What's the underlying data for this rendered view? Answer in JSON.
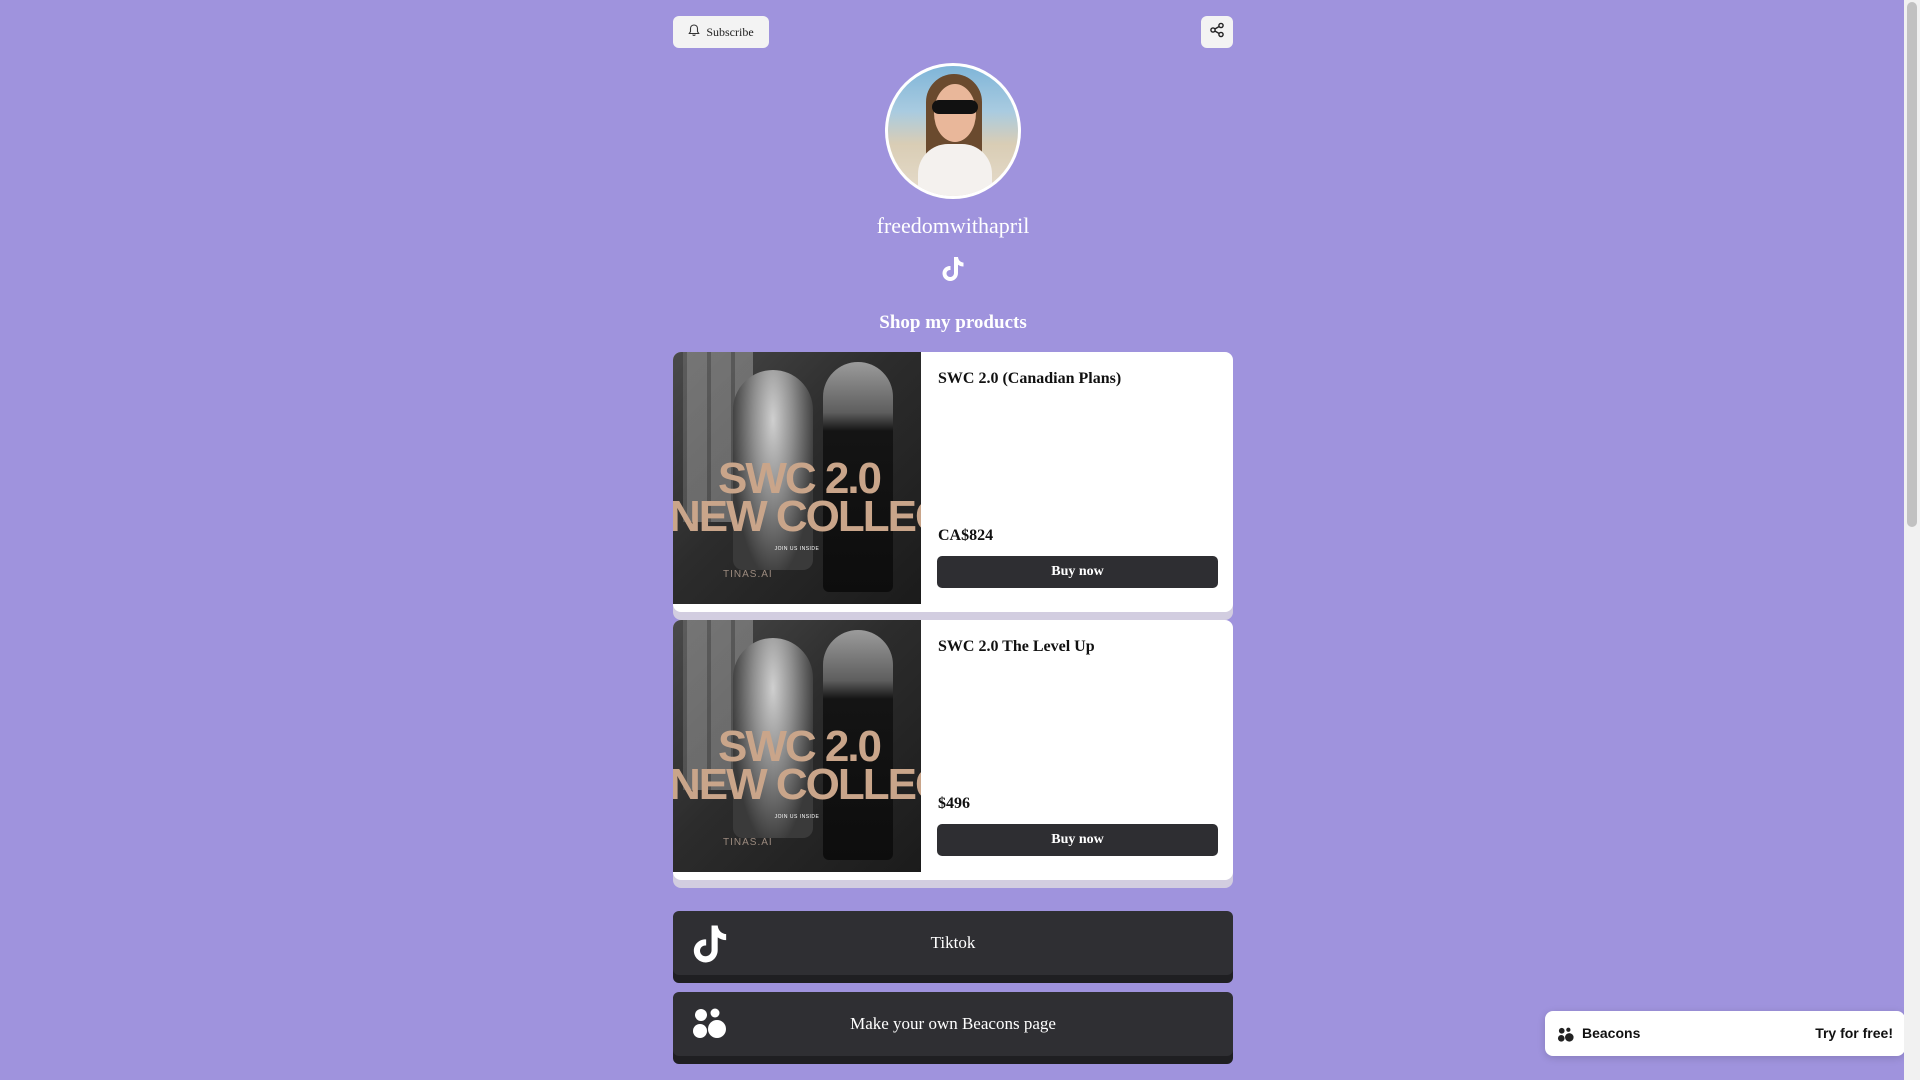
{
  "header": {
    "subscribe_label": "Subscribe",
    "bell_icon": "bell-icon",
    "share_icon": "share-icon"
  },
  "profile": {
    "username": "freedomwithapril",
    "social_icon": "tiktok-icon"
  },
  "shop": {
    "title": "Shop my products",
    "products": [
      {
        "title": "SWC 2.0 (Canadian Plans)",
        "price": "CA$824",
        "buy_label": "Buy now",
        "image_text_line1": "SWC 2.0",
        "image_text_line2": "NEW COLLECT",
        "image_small_text": "JOIN US INSIDE",
        "image_brand": "TINAS.AI"
      },
      {
        "title": "SWC 2.0 The Level Up",
        "price": "$496",
        "buy_label": "Buy now",
        "image_text_line1": "SWC 2.0",
        "image_text_line2": "NEW COLLECT",
        "image_small_text": "JOIN US INSIDE",
        "image_brand": "TINAS.AI"
      }
    ]
  },
  "links": [
    {
      "label": "Tiktok",
      "icon": "tiktok-icon"
    },
    {
      "label": "Make your own Beacons page",
      "icon": "beacons-logo-icon"
    }
  ],
  "beacons_widget": {
    "brand": "Beacons",
    "cta": "Try for free!",
    "icon": "beacons-logo-icon"
  },
  "colors": {
    "background": "#9f93dd",
    "button_dark": "#2e2e32",
    "card_bg": "#ffffff",
    "image_text": "#c9a58a"
  }
}
